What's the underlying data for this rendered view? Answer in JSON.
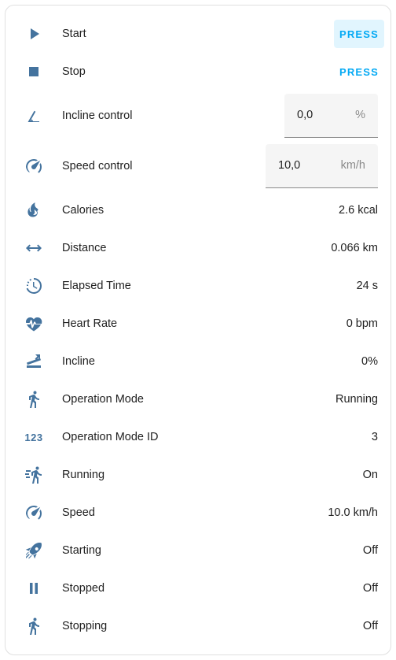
{
  "rows": [
    {
      "label": "Start",
      "icon": "play-icon",
      "action": "PRESS"
    },
    {
      "label": "Stop",
      "icon": "stop-icon",
      "action": "PRESS"
    },
    {
      "label": "Incline control",
      "icon": "angle-icon",
      "field_value": "0,0",
      "field_unit": "%"
    },
    {
      "label": "Speed control",
      "icon": "speedometer-icon",
      "field_value": "10,0",
      "field_unit": "km/h"
    },
    {
      "label": "Calories",
      "icon": "fire-icon",
      "value": "2.6 kcal"
    },
    {
      "label": "Distance",
      "icon": "arrow-left-right-icon",
      "value": "0.066 km"
    },
    {
      "label": "Elapsed Time",
      "icon": "timer-icon",
      "value": "24 s"
    },
    {
      "label": "Heart Rate",
      "icon": "heart-pulse-icon",
      "value": "0 bpm"
    },
    {
      "label": "Incline",
      "icon": "incline-icon",
      "value": "0%"
    },
    {
      "label": "Operation Mode",
      "icon": "walk-icon",
      "value": "Running"
    },
    {
      "label": "Operation Mode ID",
      "icon": "numeric-icon",
      "icon_text": "123",
      "value": "3"
    },
    {
      "label": "Running",
      "icon": "run-fast-icon",
      "value": "On"
    },
    {
      "label": "Speed",
      "icon": "speedometer-icon",
      "value": "10.0 km/h"
    },
    {
      "label": "Starting",
      "icon": "rocket-icon",
      "value": "Off"
    },
    {
      "label": "Stopped",
      "icon": "pause-icon",
      "value": "Off"
    },
    {
      "label": "Stopping",
      "icon": "walk-icon",
      "value": "Off"
    }
  ],
  "colors": {
    "icon": "#44739e",
    "accent": "#03a9f4",
    "press_hover_bg": "#e1f5fe"
  }
}
